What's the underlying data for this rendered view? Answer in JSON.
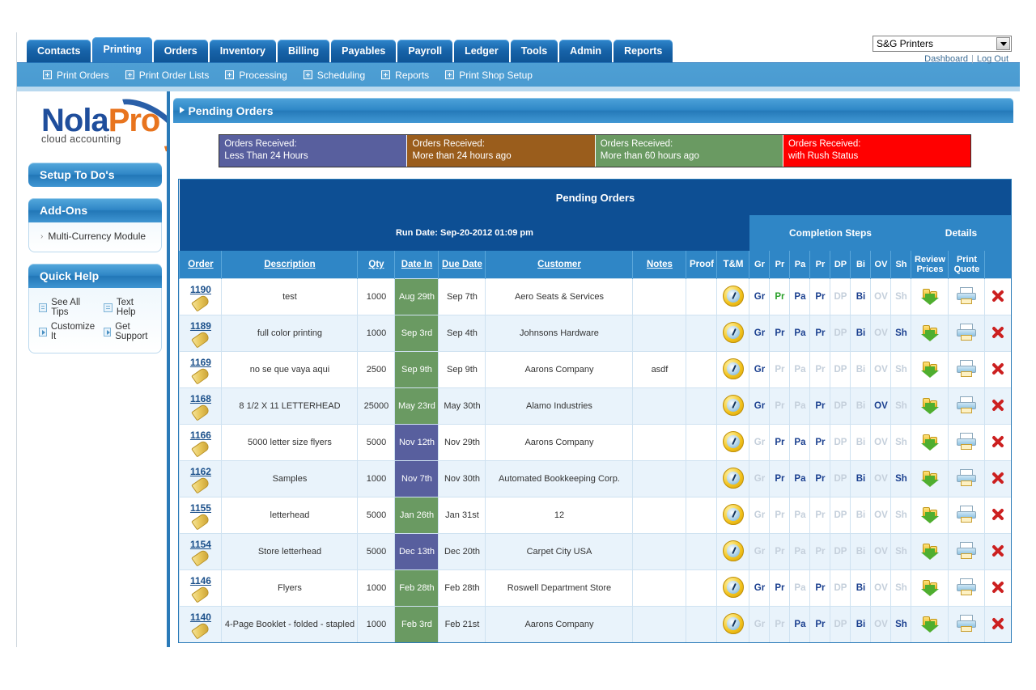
{
  "topnav": {
    "tabs": [
      {
        "label": "Contacts",
        "active": false
      },
      {
        "label": "Printing",
        "active": true
      },
      {
        "label": "Orders",
        "active": false
      },
      {
        "label": "Inventory",
        "active": false
      },
      {
        "label": "Billing",
        "active": false
      },
      {
        "label": "Payables",
        "active": false
      },
      {
        "label": "Payroll",
        "active": false
      },
      {
        "label": "Ledger",
        "active": false
      },
      {
        "label": "Tools",
        "active": false
      },
      {
        "label": "Admin",
        "active": false
      },
      {
        "label": "Reports",
        "active": false
      }
    ],
    "company_selected": "S&G Printers",
    "dashboard_link": "Dashboard",
    "logout_link": "Log Out"
  },
  "subnav": {
    "items": [
      {
        "label": "Print Orders"
      },
      {
        "label": "Print Order Lists"
      },
      {
        "label": "Processing"
      },
      {
        "label": "Scheduling"
      },
      {
        "label": "Reports"
      },
      {
        "label": "Print Shop Setup"
      }
    ]
  },
  "sidebar": {
    "logo": {
      "part1": "Nola",
      "part2": "Pro",
      "tagline": "cloud accounting"
    },
    "setup_todos": "Setup To Do's",
    "addons_title": "Add-Ons",
    "addons_items": [
      {
        "label": "Multi-Currency Module"
      }
    ],
    "quick_help_title": "Quick Help",
    "quick_help_links": [
      {
        "label": "See All Tips",
        "icon": "lines"
      },
      {
        "label": "Text Help",
        "icon": "lines"
      },
      {
        "label": "Customize It",
        "icon": "play"
      },
      {
        "label": "Get Support",
        "icon": "play"
      }
    ]
  },
  "page": {
    "banner_title": "Pending Orders",
    "legend": [
      {
        "line1": "Orders Received:",
        "line2": "Less Than 24 Hours",
        "color": "#585f9e"
      },
      {
        "line1": "Orders Received:",
        "line2": "More than 24 hours ago",
        "color": "#9a5d1c"
      },
      {
        "line1": "Orders Received:",
        "line2": "More than 60 hours ago",
        "color": "#6a9a62"
      },
      {
        "line1": "Orders Received:",
        "line2": "with Rush Status",
        "color": "#ff0000"
      }
    ],
    "table_title": "Pending Orders",
    "run_date": "Run Date: Sep-20-2012 01:09 pm",
    "group_completion": "Completion Steps",
    "group_details": "Details",
    "columns": {
      "order": "Order",
      "description": "Description",
      "qty": "Qty",
      "date_in": "Date In",
      "due_date": "Due Date",
      "customer": "Customer",
      "notes": "Notes",
      "proof": "Proof",
      "tm": "T&M",
      "steps": [
        "Gr",
        "Pr",
        "Pa",
        "Pr",
        "DP",
        "Bi",
        "OV",
        "Sh"
      ],
      "review_prices_1": "Review",
      "review_prices_2": "Prices",
      "print_quote_1": "Print",
      "print_quote_2": "Quote"
    },
    "rows": [
      {
        "order": "1190",
        "description": "test",
        "qty": "1000",
        "date_in": "Aug 29th",
        "date_color": "#6a9a62",
        "due_date": "Sep 7th",
        "customer": "Aero Seats & Services",
        "notes": "",
        "proof": "",
        "steps": [
          "done",
          "green",
          "done",
          "done",
          "todo",
          "done",
          "todo",
          "todo"
        ]
      },
      {
        "order": "1189",
        "description": "full color printing",
        "qty": "1000",
        "date_in": "Sep 3rd",
        "date_color": "#6a9a62",
        "due_date": "Sep 4th",
        "customer": "Johnsons Hardware",
        "notes": "",
        "proof": "",
        "steps": [
          "done",
          "done",
          "done",
          "done",
          "todo",
          "done",
          "todo",
          "done"
        ]
      },
      {
        "order": "1169",
        "description": "no se que vaya aqui",
        "qty": "2500",
        "date_in": "Sep 9th",
        "date_color": "#6a9a62",
        "due_date": "Sep 9th",
        "customer": "Aarons Company",
        "notes": "asdf",
        "proof": "",
        "steps": [
          "done",
          "todo",
          "todo",
          "todo",
          "todo",
          "todo",
          "todo",
          "todo"
        ]
      },
      {
        "order": "1168",
        "description": "8 1/2 X 11 LETTERHEAD",
        "qty": "25000",
        "date_in": "May 23rd",
        "date_color": "#6a9a62",
        "due_date": "May 30th",
        "customer": "Alamo Industries",
        "notes": "",
        "proof": "",
        "steps": [
          "done",
          "todo",
          "todo",
          "done",
          "todo",
          "todo",
          "done",
          "todo"
        ]
      },
      {
        "order": "1166",
        "description": "5000 letter size flyers",
        "qty": "5000",
        "date_in": "Nov 12th",
        "date_color": "#585f9e",
        "due_date": "Nov 29th",
        "customer": "Aarons Company",
        "notes": "",
        "proof": "",
        "steps": [
          "todo",
          "done",
          "done",
          "done",
          "todo",
          "todo",
          "todo",
          "todo"
        ]
      },
      {
        "order": "1162",
        "description": "Samples",
        "qty": "1000",
        "date_in": "Nov 7th",
        "date_color": "#585f9e",
        "due_date": "Nov 30th",
        "customer": "Automated Bookkeeping Corp.",
        "notes": "",
        "proof": "",
        "steps": [
          "todo",
          "done",
          "done",
          "done",
          "todo",
          "done",
          "todo",
          "done"
        ]
      },
      {
        "order": "1155",
        "description": "letterhead",
        "qty": "5000",
        "date_in": "Jan 26th",
        "date_color": "#6a9a62",
        "due_date": "Jan 31st",
        "customer": "12",
        "notes": "",
        "proof": "",
        "steps": [
          "todo",
          "todo",
          "todo",
          "todo",
          "todo",
          "todo",
          "todo",
          "todo"
        ]
      },
      {
        "order": "1154",
        "description": "Store letterhead",
        "qty": "5000",
        "date_in": "Dec 13th",
        "date_color": "#585f9e",
        "due_date": "Dec 20th",
        "customer": "Carpet City USA",
        "notes": "",
        "proof": "",
        "steps": [
          "todo",
          "todo",
          "todo",
          "todo",
          "todo",
          "todo",
          "todo",
          "todo"
        ]
      },
      {
        "order": "1146",
        "description": "Flyers",
        "qty": "1000",
        "date_in": "Feb 28th",
        "date_color": "#6a9a62",
        "due_date": "Feb 28th",
        "customer": "Roswell Department Store",
        "notes": "",
        "proof": "",
        "steps": [
          "done",
          "done",
          "todo",
          "done",
          "todo",
          "done",
          "todo",
          "todo"
        ]
      },
      {
        "order": "1140",
        "description": "4-Page Booklet - folded - stapled",
        "qty": "1000",
        "date_in": "Feb 3rd",
        "date_color": "#6a9a62",
        "due_date": "Feb 21st",
        "customer": "Aarons Company",
        "notes": "",
        "proof": "",
        "steps": [
          "todo",
          "todo",
          "done",
          "done",
          "todo",
          "done",
          "todo",
          "done"
        ]
      }
    ]
  }
}
